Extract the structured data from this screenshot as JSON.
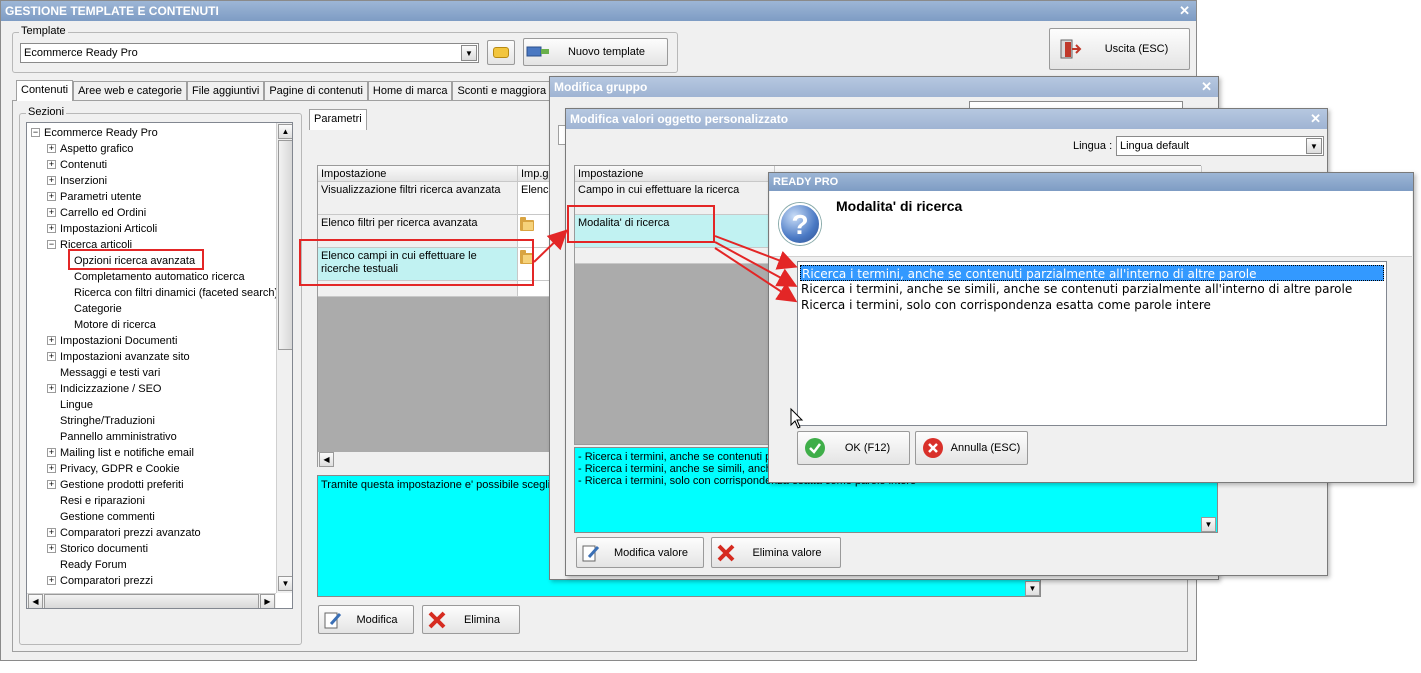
{
  "main": {
    "title": "GESTIONE TEMPLATE E CONTENUTI",
    "template_label": "Template",
    "template_value": "Ecommerce Ready Pro",
    "new_template_label": "Nuovo template",
    "exit_label": "Uscita (ESC)",
    "tabs": [
      "Contenuti",
      "Aree web e categorie",
      "File aggiuntivi",
      "Pagine di contenuti",
      "Home di marca",
      "Sconti e maggiora"
    ],
    "sections_label": "Sezioni",
    "tree": {
      "root": "Ecommerce Ready Pro",
      "items": [
        "Aspetto grafico",
        "Contenuti",
        "Inserzioni",
        "Parametri utente",
        "Carrello ed Ordini",
        "Impostazioni Articoli",
        "Ricerca articoli"
      ],
      "sub_items": [
        "Opzioni ricerca avanzata",
        "Completamento automatico ricerca",
        "Ricerca con filtri dinamici (faceted search)",
        "Categorie",
        "Motore di ricerca"
      ],
      "more_items": [
        "Impostazioni Documenti",
        "Impostazioni avanzate sito",
        "Messaggi e testi vari",
        "Indicizzazione / SEO",
        "Lingue",
        "Stringhe/Traduzioni",
        "Pannello amministrativo",
        "Mailing list e notifiche email",
        "Privacy, GDPR e Cookie",
        "Gestione prodotti preferiti",
        "Resi e riparazioni",
        "Gestione commenti",
        "Comparatori prezzi avanzato",
        "Storico documenti",
        "Ready Forum",
        "Comparatori prezzi"
      ]
    },
    "params_tab": "Parametri",
    "grid": {
      "col1": "Impostazione",
      "col2": "Imp.ge",
      "rows": [
        "Visualizzazione filtri ricerca avanzata",
        "Elenco filtri per ricerca avanzata",
        "Elenco campi in cui effettuare le ricerche testuali"
      ],
      "row1_value": "Elenc"
    },
    "description": "Tramite questa impostazione e' possibile sceglier",
    "edit_label": "Modifica",
    "delete_label": "Elimina"
  },
  "group_dialog": {
    "title": "Modifica gruppo"
  },
  "custom_dialog": {
    "title": "Modifica valori oggetto personalizzato",
    "language_label": "Lingua :",
    "language_value": "Lingua default",
    "col1": "Impostazione",
    "rows": [
      "Campo in cui effettuare la ricerca",
      "Modalita' di ricerca"
    ],
    "description": "- Ricerca i termini, anche se contenuti pa\n- Ricerca i termini, anche se simili, anche\n- Ricerca i termini, solo con corrispondenza esatta come parole intere",
    "edit_value_label": "Modifica valore",
    "delete_value_label": "Elimina valore"
  },
  "ready_dialog": {
    "title": "READY PRO",
    "heading": "Modalita' di ricerca",
    "options": [
      "Ricerca i termini, anche se contenuti parzialmente all'interno di altre parole",
      "Ricerca i termini, anche se simili, anche se contenuti parzialmente all'interno di altre parole",
      "Ricerca i termini, solo con corrispondenza esatta come parole intere"
    ],
    "ok_label": "OK (F12)",
    "cancel_label": "Annulla (ESC)"
  },
  "colors": {
    "selection_cyan": "#00ffff",
    "row_highlight": "#c1f2f2",
    "list_selected": "#3399ff",
    "annotation_red": "#e32626",
    "titlebar": "#8aa6cc"
  }
}
